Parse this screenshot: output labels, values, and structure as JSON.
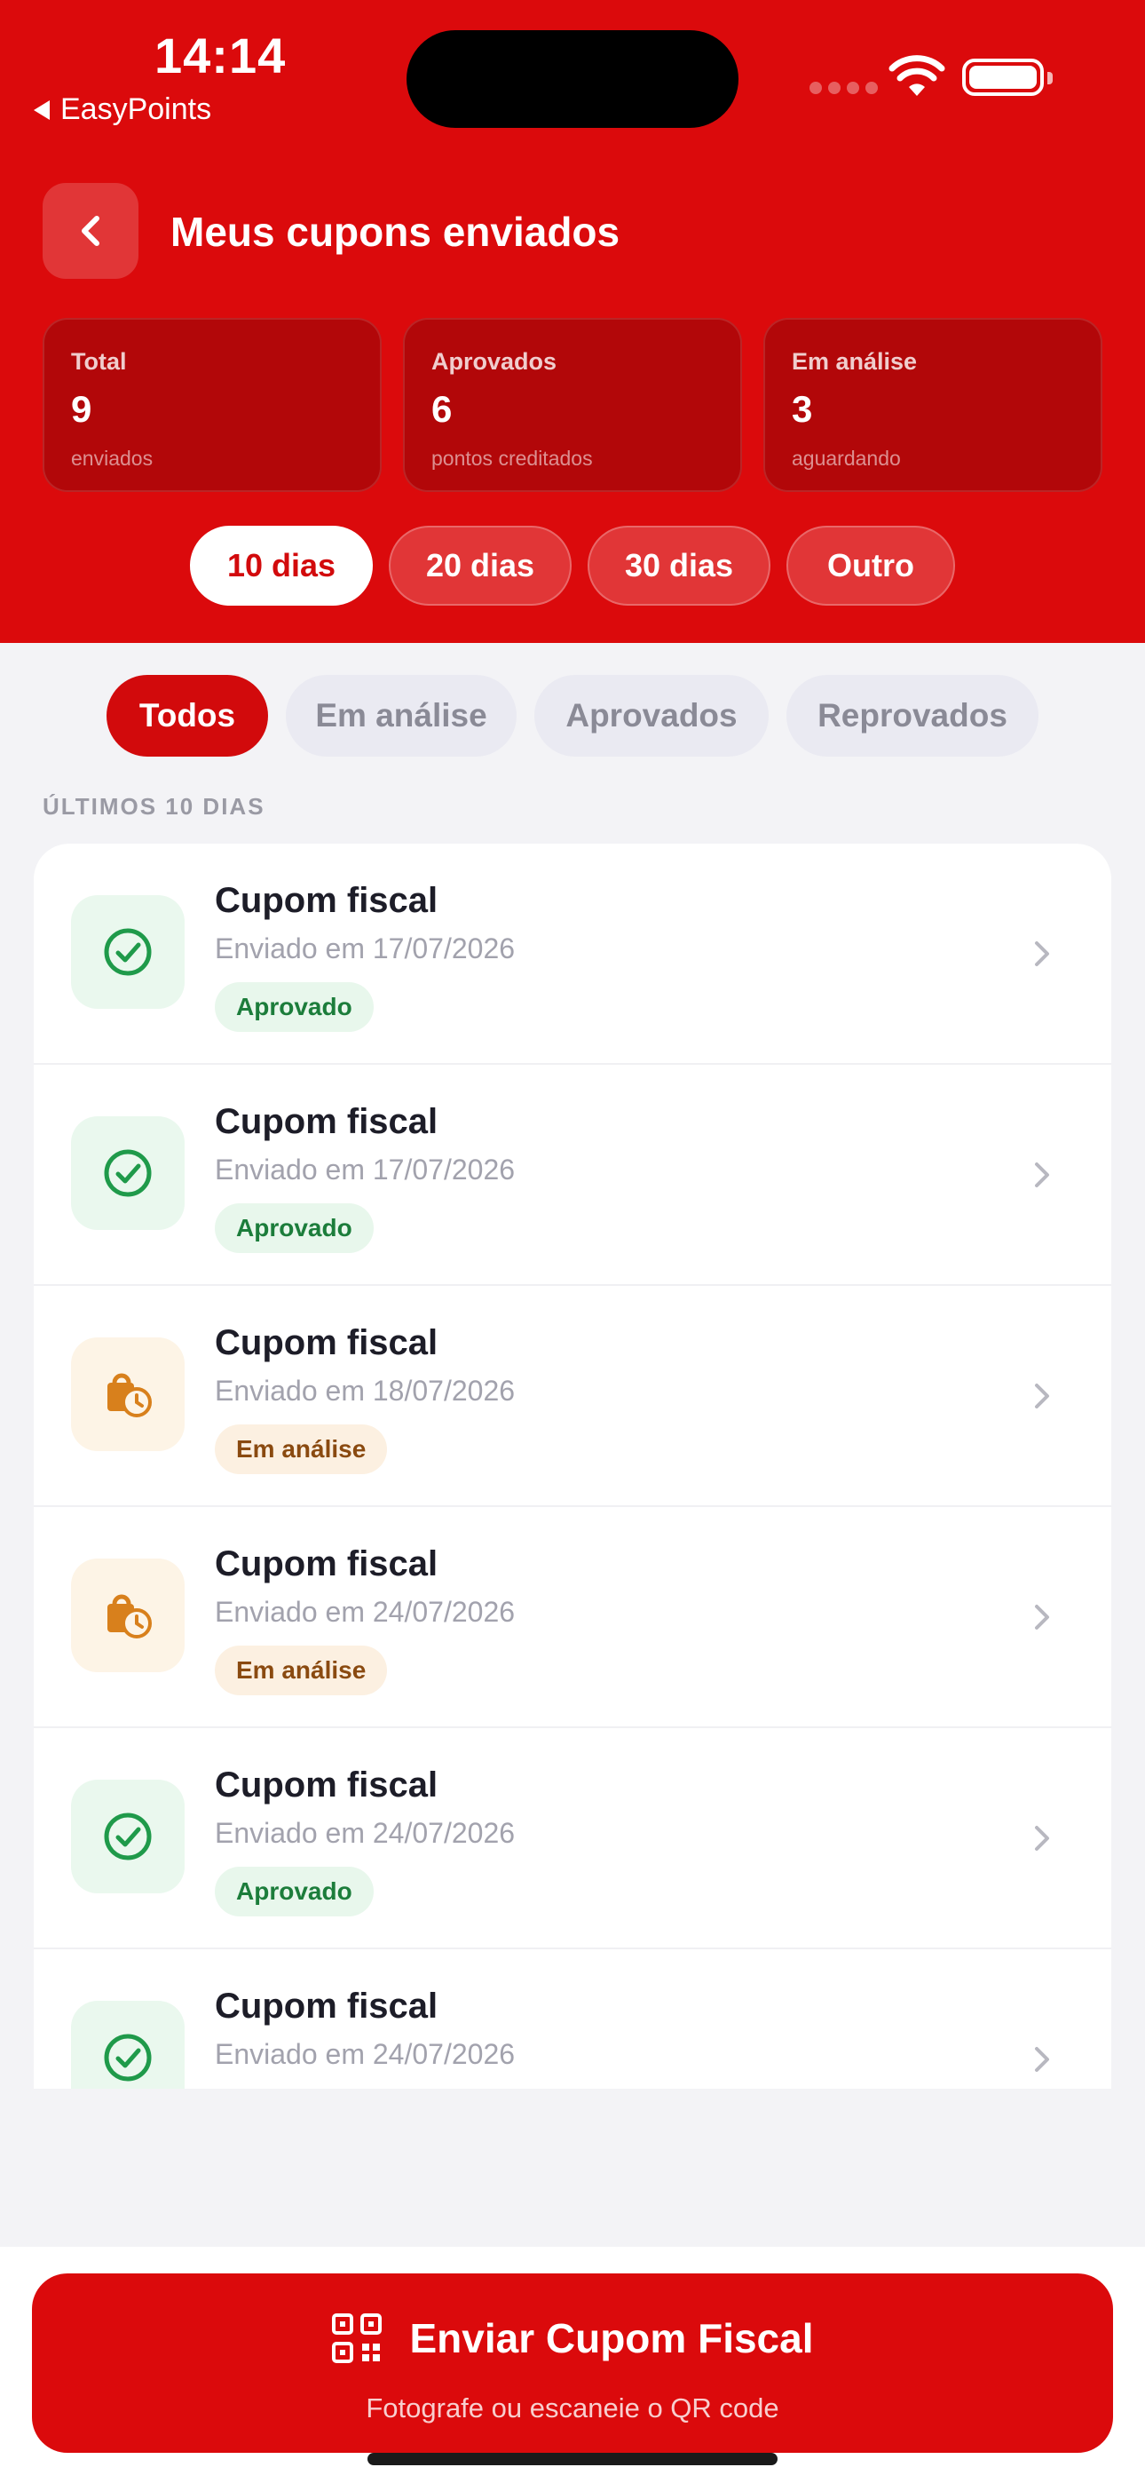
{
  "status_bar": {
    "time": "14:14",
    "back_app": "EasyPoints"
  },
  "header": {
    "title": "Meus cupons enviados"
  },
  "stats": [
    {
      "label": "Total",
      "value": "9",
      "sub": "enviados"
    },
    {
      "label": "Aprovados",
      "value": "6",
      "sub": "pontos creditados"
    },
    {
      "label": "Em análise",
      "value": "3",
      "sub": "aguardando"
    }
  ],
  "periods": [
    "10 dias",
    "20 dias",
    "30 dias",
    "Outro"
  ],
  "selected_period": "10 dias",
  "filters": [
    "Todos",
    "Em análise",
    "Aprovados",
    "Reprovados"
  ],
  "selected_filter": "Todos",
  "section_label": "ÚLTIMOS 10 DIAS",
  "coupons": [
    {
      "title": "Cupom fiscal",
      "date": "Enviado em 17/07/2026",
      "status": "Aprovado",
      "icon": "check-circle-icon"
    },
    {
      "title": "Cupom fiscal",
      "date": "Enviado em 17/07/2026",
      "status": "Aprovado",
      "icon": "check-circle-icon"
    },
    {
      "title": "Cupom fiscal",
      "date": "Enviado em 18/07/2026",
      "status": "Em análise",
      "icon": "bag-clock-icon"
    },
    {
      "title": "Cupom fiscal",
      "date": "Enviado em 24/07/2026",
      "status": "Em análise",
      "icon": "bag-clock-icon"
    },
    {
      "title": "Cupom fiscal",
      "date": "Enviado em 24/07/2026",
      "status": "Aprovado",
      "icon": "check-circle-icon"
    },
    {
      "title": "Cupom fiscal",
      "date": "Enviado em 24/07/2026",
      "status": "",
      "icon": "check-circle-icon"
    }
  ],
  "send_button": {
    "label": "Enviar Cupom Fiscal",
    "sub": "Fotografe ou escaneie o QR code",
    "icon": "qr-code-icon"
  },
  "colors": {
    "brand": "#db0a0c",
    "approved": "#1c7d3b",
    "pending": "#d8801c"
  }
}
